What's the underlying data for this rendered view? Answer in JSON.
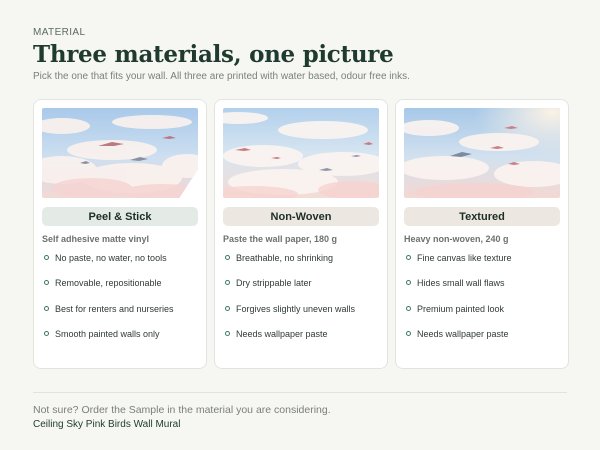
{
  "header": {
    "eyebrow": "MATERIAL",
    "title": "Three materials, one picture",
    "subtitle": "Pick the one that fits your wall. All three are printed with water based, odour free inks."
  },
  "cards": [
    {
      "name": "Peel & Stick",
      "spec": "Self adhesive matte vinyl",
      "pill_color": "#e4ebe7",
      "features": [
        "No paste, no water, no tools",
        "Removable, repositionable",
        "Best for renters and nurseries",
        "Smooth painted walls only"
      ]
    },
    {
      "name": "Non-Woven",
      "spec": "Paste the wall paper, 180 g",
      "pill_color": "#ece7e1",
      "features": [
        "Breathable, no shrinking",
        "Dry strippable later",
        "Forgives slightly uneven walls",
        "Needs wallpaper paste"
      ]
    },
    {
      "name": "Textured",
      "spec": "Heavy non-woven, 240 g",
      "pill_color": "#ece7e1",
      "features": [
        "Fine canvas like texture",
        "Hides small wall flaws",
        "Premium painted look",
        "Needs wallpaper paste"
      ]
    }
  ],
  "footer": {
    "note": "Not sure? Order the Sample in the material you are considering.",
    "product": "Ceiling Sky Pink Birds Wall Mural"
  },
  "colors": {
    "accent_green": "#1f3a2e",
    "bullet": "#3c7a5d",
    "background": "#f6f6f3"
  }
}
